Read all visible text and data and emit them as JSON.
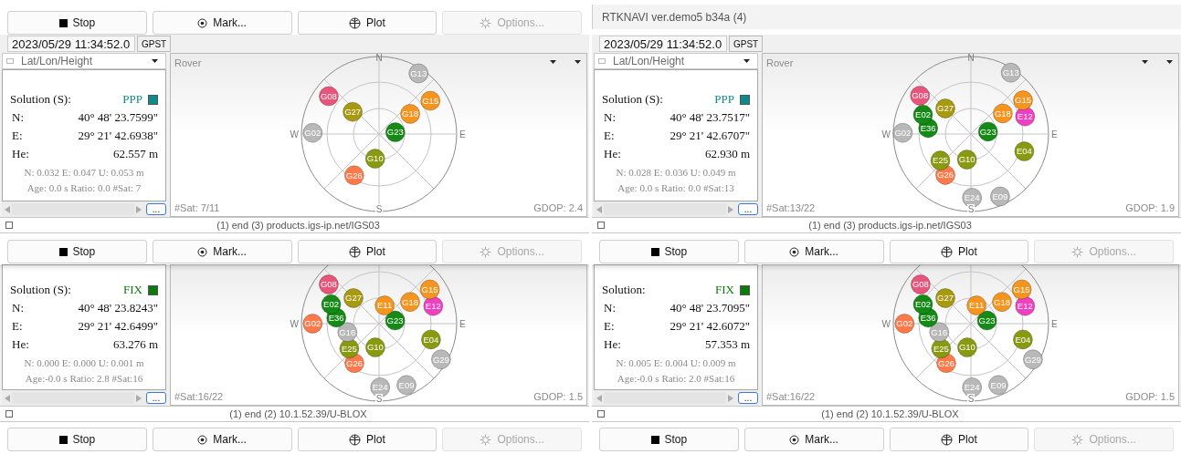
{
  "windows": [
    {
      "toolbar_top": [
        {
          "label": "Stop",
          "kind": "stop",
          "disabled": false
        },
        {
          "label": "Mark...",
          "kind": "mark",
          "disabled": false
        },
        {
          "label": "Plot",
          "kind": "plot",
          "disabled": false
        },
        {
          "label": "Options...",
          "kind": "options",
          "disabled": true
        }
      ],
      "time": "2023/05/29 11:34:52.0",
      "time_system": "GPST",
      "panel": {
        "format": "Lat/Lon/Height",
        "plot_title": "Rover",
        "solution_label": "Solution (S):",
        "solution": {
          "text": "PPP",
          "color": "#0f8a8a"
        },
        "coords": [
          {
            "label": "N:",
            "value": "40° 48' 23.7599\""
          },
          {
            "label": "E:",
            "value": "29° 21' 42.6938\""
          },
          {
            "label": "He:",
            "value": "62.557 m"
          }
        ],
        "accuracy": "N: 0.032 E: 0.047 U: 0.053 m",
        "age": "Age: 0.0 s Ratio: 0.0 #Sat: 7",
        "more": "...",
        "sat_count": "#Sat: 7/11",
        "gdop": "GDOP: 2.4",
        "compass": {
          "north": "N",
          "east": "E",
          "south": "S",
          "west": "W"
        },
        "satellites": [
          {
            "id": "G13",
            "color": "#b8b8b8"
          },
          {
            "id": "G08",
            "color": "#e8557a"
          },
          {
            "id": "G15",
            "color": "#f7941d"
          },
          {
            "id": "G27",
            "color": "#a89a10"
          },
          {
            "id": "G18",
            "color": "#f7941d"
          },
          {
            "id": "G02",
            "color": "#b8b8b8"
          },
          {
            "id": "G23",
            "color": "#168a16"
          },
          {
            "id": "G10",
            "color": "#8a9a10"
          },
          {
            "id": "G26",
            "color": "#ff7a4a"
          }
        ]
      },
      "status": "(1) end (3) products.igs-ip.net/IGS03"
    },
    {
      "toolbar_top": [
        {
          "label": "Stop",
          "kind": "stop",
          "disabled": false
        },
        {
          "label": "Mark...",
          "kind": "mark",
          "disabled": false
        },
        {
          "label": "Plot",
          "kind": "plot",
          "disabled": false
        },
        {
          "label": "Options...",
          "kind": "options",
          "disabled": true
        }
      ],
      "panel": {
        "solution_label": "Solution (S):",
        "solution": {
          "text": "FIX",
          "color": "#0a7a0a"
        },
        "coords": [
          {
            "label": "N:",
            "value": "40° 48' 23.8243\""
          },
          {
            "label": "E:",
            "value": "29° 21' 42.6499\""
          },
          {
            "label": "He:",
            "value": "63.276 m"
          }
        ],
        "accuracy": "N: 0.000 E: 0.000 U: 0.001 m",
        "age": "Age:-0.0 s Ratio: 2.8 #Sat:16",
        "more": "...",
        "sat_count": "#Sat:16/22",
        "gdop": "GDOP: 1.5",
        "compass": {
          "east": "E",
          "south": "S",
          "west": "W"
        },
        "satellites": [
          {
            "id": "G08",
            "color": "#e8557a"
          },
          {
            "id": "G15",
            "color": "#f7941d"
          },
          {
            "id": "E02",
            "color": "#168a16"
          },
          {
            "id": "G27",
            "color": "#a89a10"
          },
          {
            "id": "E11",
            "color": "#f7941d"
          },
          {
            "id": "G18",
            "color": "#f7941d"
          },
          {
            "id": "E12",
            "color": "#f040c0"
          },
          {
            "id": "G02",
            "color": "#ff7a4a"
          },
          {
            "id": "E36",
            "color": "#168a16"
          },
          {
            "id": "G23",
            "color": "#168a16"
          },
          {
            "id": "G16",
            "color": "#b8b8b8"
          },
          {
            "id": "E04",
            "color": "#8a9a10"
          },
          {
            "id": "E25",
            "color": "#8a9a10"
          },
          {
            "id": "G10",
            "color": "#8a9a10"
          },
          {
            "id": "G26",
            "color": "#ff7a4a"
          },
          {
            "id": "G29",
            "color": "#b8b8b8"
          },
          {
            "id": "E24",
            "color": "#b8b8b8"
          },
          {
            "id": "E09",
            "color": "#b8b8b8"
          }
        ]
      },
      "status": "(1) end (2) 10.1.52.39/U-BLOX",
      "toolbar_bottom": [
        {
          "label": "Stop",
          "kind": "stop",
          "disabled": false
        },
        {
          "label": "Mark...",
          "kind": "mark",
          "disabled": false
        },
        {
          "label": "Plot",
          "kind": "plot",
          "disabled": false
        },
        {
          "label": "Options...",
          "kind": "options",
          "disabled": true
        }
      ]
    },
    {
      "title": "RTKNAVI ver.demo5 b34a (4)",
      "time": "2023/05/29 11:34:52.0",
      "time_system": "GPST",
      "panel": {
        "format": "Lat/Lon/Height",
        "plot_title": "Rover",
        "solution_label": "Solution (S):",
        "solution": {
          "text": "PPP",
          "color": "#0f8a8a"
        },
        "coords": [
          {
            "label": "N:",
            "value": "40° 48' 23.7517\""
          },
          {
            "label": "E:",
            "value": "29° 21' 42.6707\""
          },
          {
            "label": "He:",
            "value": "62.930 m"
          }
        ],
        "accuracy": "N: 0.028 E: 0.036 U: 0.049 m",
        "age": "Age: 0.0 s Ratio: 0.0 #Sat:13",
        "more": "...",
        "sat_count": "#Sat:13/22",
        "gdop": "GDOP: 1.9",
        "compass": {
          "north": "N",
          "east": "E",
          "south": "S",
          "west": "W"
        },
        "satellites": [
          {
            "id": "G13",
            "color": "#b8b8b8"
          },
          {
            "id": "G08",
            "color": "#e8557a"
          },
          {
            "id": "E02",
            "color": "#168a16"
          },
          {
            "id": "G27",
            "color": "#a89a10"
          },
          {
            "id": "E36",
            "color": "#168a16"
          },
          {
            "id": "G15",
            "color": "#f7941d"
          },
          {
            "id": "E12",
            "color": "#f040c0"
          },
          {
            "id": "G18",
            "color": "#f7941d"
          },
          {
            "id": "G02",
            "color": "#b8b8b8"
          },
          {
            "id": "G23",
            "color": "#168a16"
          },
          {
            "id": "E04",
            "color": "#8a9a10"
          },
          {
            "id": "G10",
            "color": "#8a9a10"
          },
          {
            "id": "E25",
            "color": "#8a9a10"
          },
          {
            "id": "G26",
            "color": "#ff7a4a"
          },
          {
            "id": "E24",
            "color": "#b8b8b8"
          },
          {
            "id": "E09",
            "color": "#b8b8b8"
          }
        ]
      },
      "status": "(1) end (3) products.igs-ip.net/IGS03"
    },
    {
      "toolbar_top": [
        {
          "label": "Stop",
          "kind": "stop",
          "disabled": false
        },
        {
          "label": "Mark...",
          "kind": "mark",
          "disabled": false
        },
        {
          "label": "Plot",
          "kind": "plot",
          "disabled": false
        },
        {
          "label": "Options...",
          "kind": "options",
          "disabled": true
        }
      ],
      "panel": {
        "solution_label": "Solution:",
        "solution": {
          "text": "FIX",
          "color": "#0a7a0a"
        },
        "coords": [
          {
            "label": "N:",
            "value": "40° 48' 23.7095\""
          },
          {
            "label": "E:",
            "value": "29° 21' 42.6072\""
          },
          {
            "label": "He:",
            "value": "57.353 m"
          }
        ],
        "accuracy": "N: 0.005 E: 0.004 U: 0.009 m",
        "age": "Age:-0.0 s Ratio: 2.0 #Sat:16",
        "more": "...",
        "sat_count": "#Sat:16/22",
        "gdop": "GDOP: 1.5",
        "compass": {
          "east": "E",
          "south": "S",
          "west": "W"
        },
        "satellites": [
          {
            "id": "G08",
            "color": "#e8557a"
          },
          {
            "id": "G15",
            "color": "#f7941d"
          },
          {
            "id": "E02",
            "color": "#168a16"
          },
          {
            "id": "G27",
            "color": "#a89a10"
          },
          {
            "id": "E11",
            "color": "#f7941d"
          },
          {
            "id": "G18",
            "color": "#f7941d"
          },
          {
            "id": "E12",
            "color": "#f040c0"
          },
          {
            "id": "G02",
            "color": "#ff7a4a"
          },
          {
            "id": "E36",
            "color": "#168a16"
          },
          {
            "id": "G23",
            "color": "#168a16"
          },
          {
            "id": "G16",
            "color": "#b8b8b8"
          },
          {
            "id": "E04",
            "color": "#8a9a10"
          },
          {
            "id": "E25",
            "color": "#8a9a10"
          },
          {
            "id": "G10",
            "color": "#8a9a10"
          },
          {
            "id": "G26",
            "color": "#ff7a4a"
          },
          {
            "id": "G29",
            "color": "#b8b8b8"
          },
          {
            "id": "E24",
            "color": "#b8b8b8"
          },
          {
            "id": "E09",
            "color": "#b8b8b8"
          }
        ]
      },
      "status": "(1) end (2) 10.1.52.39/U-BLOX",
      "toolbar_bottom": [
        {
          "label": "Stop",
          "kind": "stop",
          "disabled": false
        },
        {
          "label": "Mark...",
          "kind": "mark",
          "disabled": false
        },
        {
          "label": "Plot",
          "kind": "plot",
          "disabled": false
        },
        {
          "label": "Options...",
          "kind": "options",
          "disabled": true
        }
      ]
    }
  ]
}
